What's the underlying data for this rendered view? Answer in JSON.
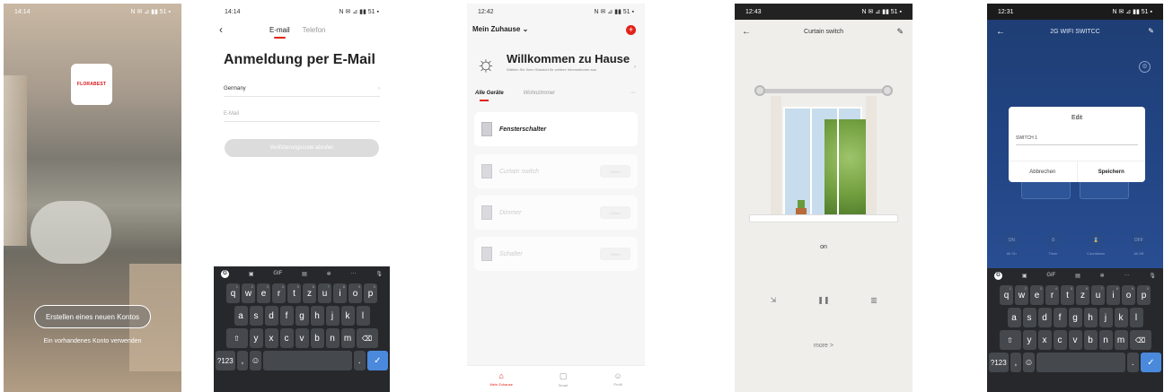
{
  "screen1": {
    "status_time": "14:14",
    "status_icons": "N ✉ ⊿ ▮▮ 51 ▪",
    "brand": "FLORABEST",
    "create_account": "Erstellen eines neuen Kontos",
    "existing_account": "Ein vorhandenes Konto verwenden"
  },
  "screen2": {
    "status_time": "14:14",
    "status_icons": "N ✉ ⊿ ▮▮ 51 ▪",
    "tab_email": "E-mail",
    "tab_phone": "Telefon",
    "title": "Anmeldung per E-Mail",
    "country": "Germany",
    "email_placeholder": "E-Mail",
    "verify_button": "Verifizierungscode abrufen",
    "keyboard": {
      "gif": "GIF",
      "row1": [
        "q",
        "w",
        "e",
        "r",
        "t",
        "z",
        "u",
        "i",
        "o",
        "p"
      ],
      "row1_sup": [
        "1",
        "2",
        "3",
        "4",
        "5",
        "6",
        "7",
        "8",
        "9",
        "0"
      ],
      "row2": [
        "a",
        "s",
        "d",
        "f",
        "g",
        "h",
        "j",
        "k",
        "l"
      ],
      "row3": [
        "y",
        "x",
        "c",
        "v",
        "b",
        "n",
        "m"
      ],
      "sym": "?123"
    }
  },
  "screen3": {
    "status_time": "12:42",
    "status_icons": "N ✉ ⊿ ▮▮ 51 ▪",
    "home": "Mein Zuhause",
    "welcome": "Willkommen zu Hause",
    "welcome_sub": "Wählen Sie Ihren Standort für weitere Informationen aus",
    "tab_all": "Alle Geräte",
    "tab_living": "Wohnzimmer",
    "devices": [
      {
        "name": "Fensterschalter",
        "switch": ""
      },
      {
        "name": "Curtain switch",
        "switch": "Offline"
      },
      {
        "name": "Dimmer",
        "switch": "Offline"
      },
      {
        "name": "Schalter",
        "switch": "Offline"
      }
    ],
    "nav": [
      "Mein Zuhause",
      "Smart",
      "Profil"
    ]
  },
  "screen4": {
    "status_time": "12:43",
    "status_icons": "N ✉ ⊿ ▮▮ 51 ▪",
    "title": "Curtain switch",
    "status": "on",
    "more": "more >"
  },
  "screen5": {
    "status_time": "12:31",
    "status_icons": "N ✉ ⊿ ▮▮ 51 ▪",
    "title": "2G WIFI SWITCC",
    "dialog_title": "Edit",
    "dialog_value": "SWITCH 1",
    "cancel": "Abbrechen",
    "save": "Speichern",
    "bottom": [
      {
        "icon": "ON",
        "label": "All On"
      },
      {
        "icon": "⏱",
        "label": "Timer"
      },
      {
        "icon": "⌛",
        "label": "Countdown"
      },
      {
        "icon": "OFF",
        "label": "All Off"
      }
    ]
  },
  "colors": {
    "accent_red": "#e2231a",
    "keyboard": "#26282c",
    "blue_bg": "#224585",
    "enter_key": "#4a89dc"
  }
}
